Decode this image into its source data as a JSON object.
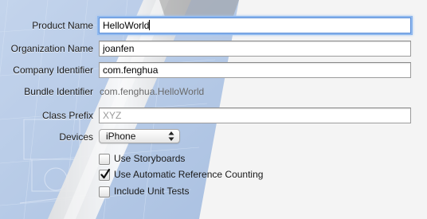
{
  "fields": {
    "product_name": {
      "label": "Product Name",
      "value": "HelloWorld"
    },
    "organization_name": {
      "label": "Organization Name",
      "value": "joanfen"
    },
    "company_identifier": {
      "label": "Company Identifier",
      "value": "com.fenghua"
    },
    "bundle_identifier": {
      "label": "Bundle Identifier",
      "value": "com.fenghua.HelloWorld"
    },
    "class_prefix": {
      "label": "Class Prefix",
      "placeholder": "XYZ"
    },
    "devices": {
      "label": "Devices",
      "value": "iPhone"
    }
  },
  "options": {
    "use_storyboards": {
      "label": "Use Storyboards",
      "checked": false
    },
    "use_arc": {
      "label": "Use Automatic Reference Counting",
      "checked": true
    },
    "include_unit_tests": {
      "label": "Include Unit Tests",
      "checked": false
    }
  },
  "colors": {
    "focus_ring": "#8fb8ee",
    "blueprint": "#7ea6dd"
  }
}
